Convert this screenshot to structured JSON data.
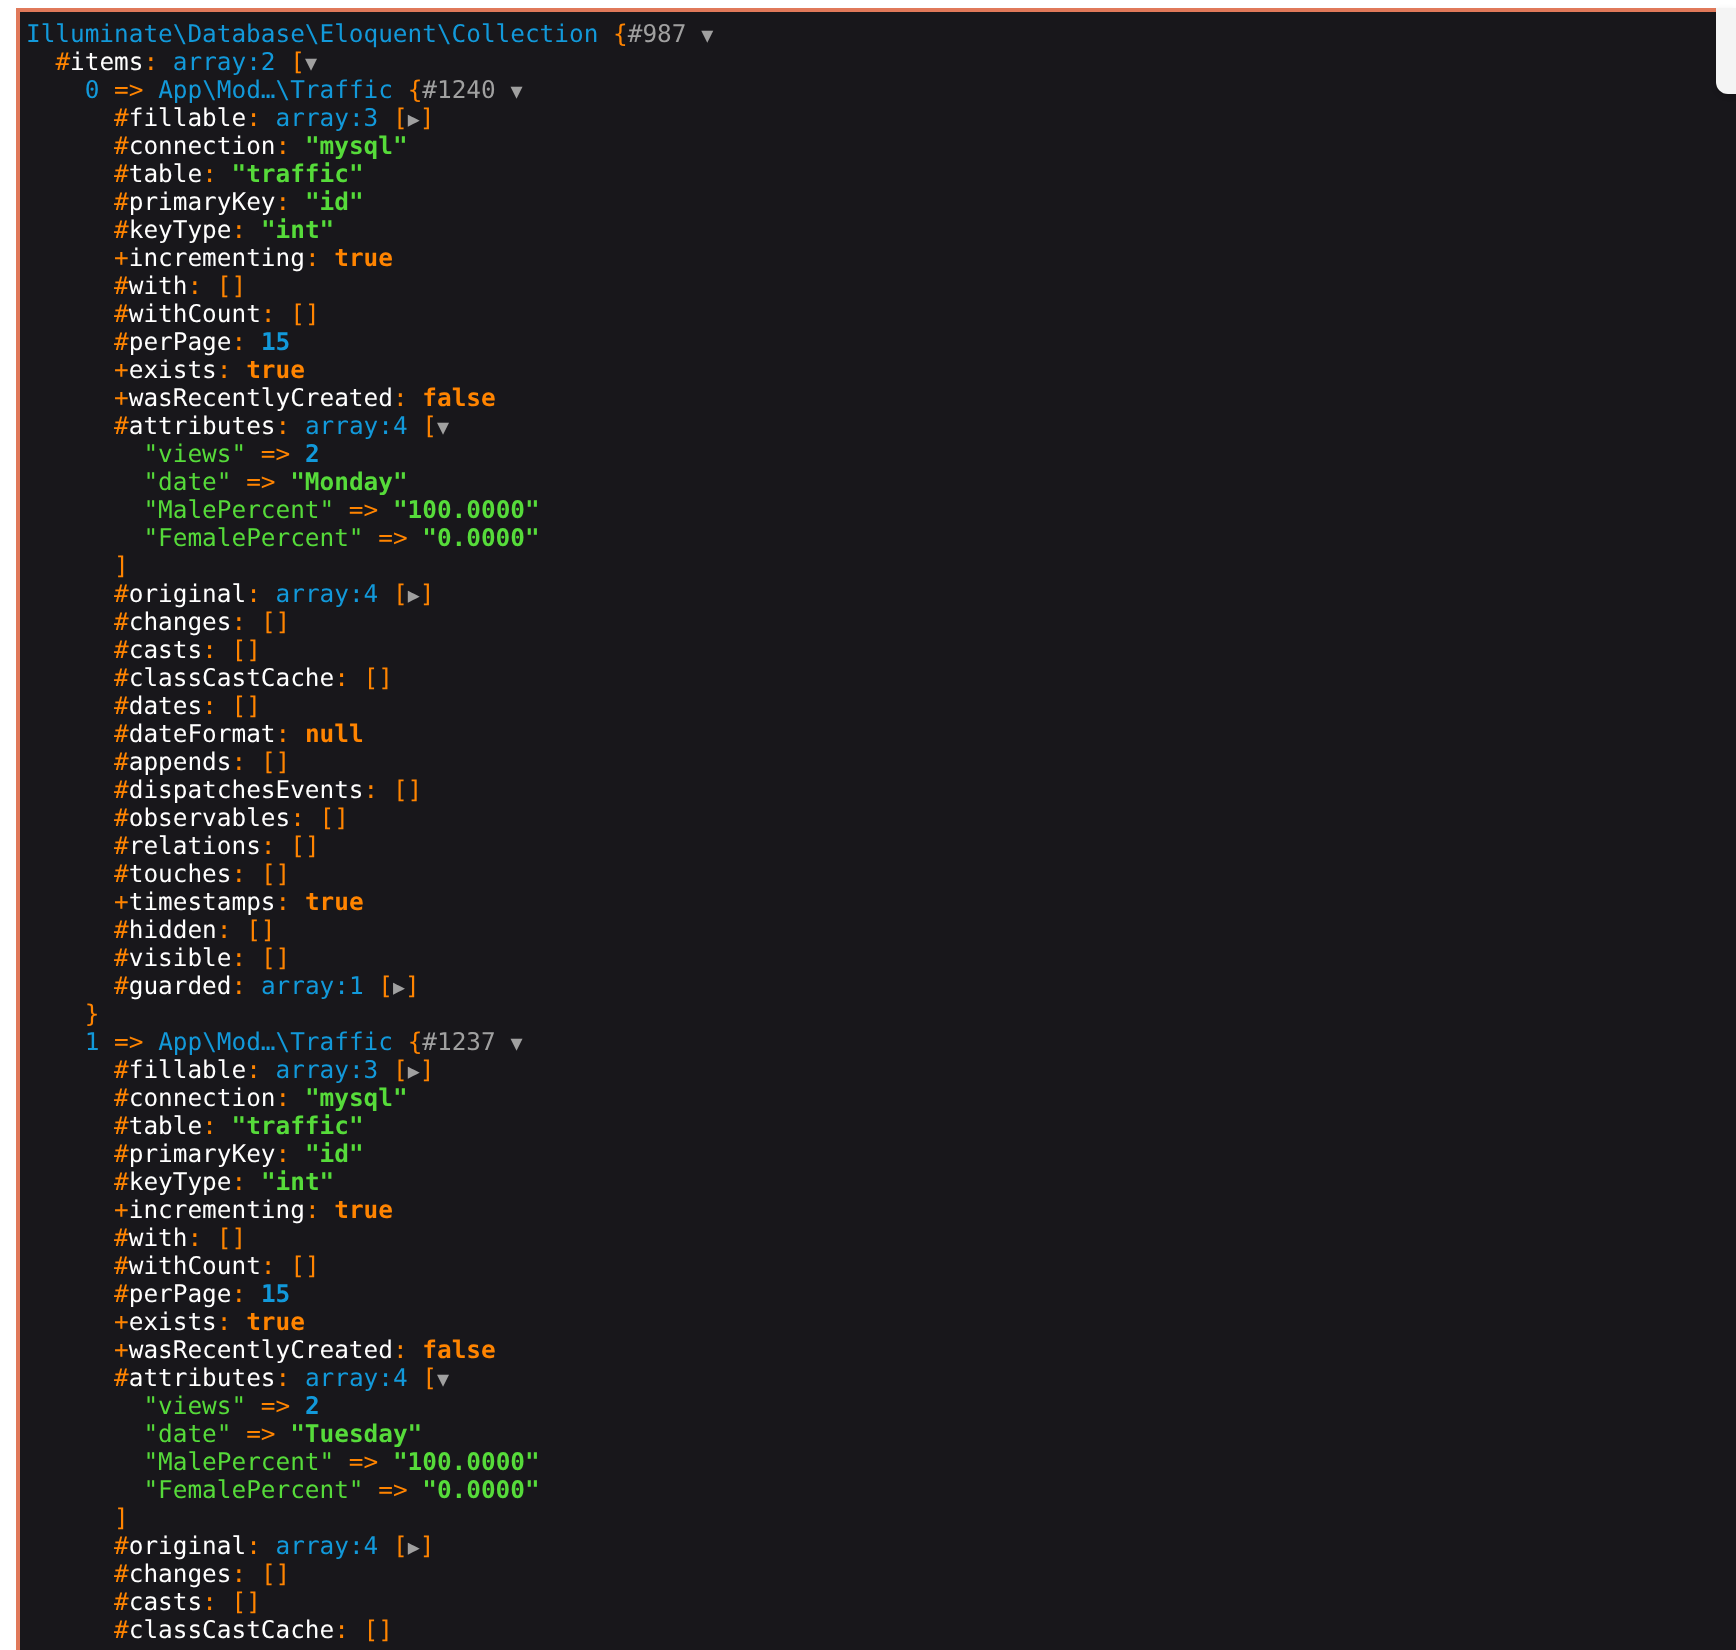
{
  "dump": {
    "value": {
      "text": "Illuminate\\Database\\Eloquent\\Collection",
      "kind": "class"
    },
    "open": "{",
    "ref": "#987",
    "toggle": "▼",
    "children": [
      {
        "key": {
          "prefix": "#",
          "text": "items",
          "kind": "property"
        },
        "sep": ": ",
        "value": {
          "text": "array:2",
          "kind": "note"
        },
        "open": "[",
        "toggle": "▼",
        "children": [
          {
            "key": {
              "text": "0",
              "kind": "index"
            },
            "sep": " => ",
            "value": {
              "text": "App\\Mod…\\Traffic",
              "kind": "class"
            },
            "open": "{",
            "ref": "#1240",
            "toggle": "▼",
            "close": "}",
            "children": [
              {
                "key": {
                  "prefix": "#",
                  "text": "fillable",
                  "kind": "property"
                },
                "sep": ": ",
                "value": {
                  "text": "array:3",
                  "kind": "note"
                },
                "open": "[",
                "toggle": "▶",
                "close": "]"
              },
              {
                "key": {
                  "prefix": "#",
                  "text": "connection",
                  "kind": "property"
                },
                "sep": ": ",
                "value": {
                  "text": "\"mysql\"",
                  "kind": "string"
                }
              },
              {
                "key": {
                  "prefix": "#",
                  "text": "table",
                  "kind": "property"
                },
                "sep": ": ",
                "value": {
                  "text": "\"traffic\"",
                  "kind": "string"
                }
              },
              {
                "key": {
                  "prefix": "#",
                  "text": "primaryKey",
                  "kind": "property"
                },
                "sep": ": ",
                "value": {
                  "text": "\"id\"",
                  "kind": "string"
                }
              },
              {
                "key": {
                  "prefix": "#",
                  "text": "keyType",
                  "kind": "property"
                },
                "sep": ": ",
                "value": {
                  "text": "\"int\"",
                  "kind": "string"
                }
              },
              {
                "key": {
                  "prefix": "+",
                  "text": "incrementing",
                  "kind": "property"
                },
                "sep": ": ",
                "value": {
                  "text": "true",
                  "kind": "const"
                }
              },
              {
                "key": {
                  "prefix": "#",
                  "text": "with",
                  "kind": "property"
                },
                "sep": ": ",
                "value": {
                  "text": "[]",
                  "kind": "empty"
                }
              },
              {
                "key": {
                  "prefix": "#",
                  "text": "withCount",
                  "kind": "property"
                },
                "sep": ": ",
                "value": {
                  "text": "[]",
                  "kind": "empty"
                }
              },
              {
                "key": {
                  "prefix": "#",
                  "text": "perPage",
                  "kind": "property"
                },
                "sep": ": ",
                "value": {
                  "text": "15",
                  "kind": "number"
                }
              },
              {
                "key": {
                  "prefix": "+",
                  "text": "exists",
                  "kind": "property"
                },
                "sep": ": ",
                "value": {
                  "text": "true",
                  "kind": "const"
                }
              },
              {
                "key": {
                  "prefix": "+",
                  "text": "wasRecentlyCreated",
                  "kind": "property"
                },
                "sep": ": ",
                "value": {
                  "text": "false",
                  "kind": "const"
                }
              },
              {
                "key": {
                  "prefix": "#",
                  "text": "attributes",
                  "kind": "property"
                },
                "sep": ": ",
                "value": {
                  "text": "array:4",
                  "kind": "note"
                },
                "open": "[",
                "toggle": "▼",
                "close": "]",
                "children": [
                  {
                    "key": {
                      "text": "\"views\"",
                      "kind": "string"
                    },
                    "sep": " => ",
                    "value": {
                      "text": "2",
                      "kind": "number"
                    }
                  },
                  {
                    "key": {
                      "text": "\"date\"",
                      "kind": "string"
                    },
                    "sep": " => ",
                    "value": {
                      "text": "\"Monday\"",
                      "kind": "string"
                    }
                  },
                  {
                    "key": {
                      "text": "\"MalePercent\"",
                      "kind": "string"
                    },
                    "sep": " => ",
                    "value": {
                      "text": "\"100.0000\"",
                      "kind": "string"
                    }
                  },
                  {
                    "key": {
                      "text": "\"FemalePercent\"",
                      "kind": "string"
                    },
                    "sep": " => ",
                    "value": {
                      "text": "\"0.0000\"",
                      "kind": "string"
                    }
                  }
                ]
              },
              {
                "key": {
                  "prefix": "#",
                  "text": "original",
                  "kind": "property"
                },
                "sep": ": ",
                "value": {
                  "text": "array:4",
                  "kind": "note"
                },
                "open": "[",
                "toggle": "▶",
                "close": "]"
              },
              {
                "key": {
                  "prefix": "#",
                  "text": "changes",
                  "kind": "property"
                },
                "sep": ": ",
                "value": {
                  "text": "[]",
                  "kind": "empty"
                }
              },
              {
                "key": {
                  "prefix": "#",
                  "text": "casts",
                  "kind": "property"
                },
                "sep": ": ",
                "value": {
                  "text": "[]",
                  "kind": "empty"
                }
              },
              {
                "key": {
                  "prefix": "#",
                  "text": "classCastCache",
                  "kind": "property"
                },
                "sep": ": ",
                "value": {
                  "text": "[]",
                  "kind": "empty"
                }
              },
              {
                "key": {
                  "prefix": "#",
                  "text": "dates",
                  "kind": "property"
                },
                "sep": ": ",
                "value": {
                  "text": "[]",
                  "kind": "empty"
                }
              },
              {
                "key": {
                  "prefix": "#",
                  "text": "dateFormat",
                  "kind": "property"
                },
                "sep": ": ",
                "value": {
                  "text": "null",
                  "kind": "const"
                }
              },
              {
                "key": {
                  "prefix": "#",
                  "text": "appends",
                  "kind": "property"
                },
                "sep": ": ",
                "value": {
                  "text": "[]",
                  "kind": "empty"
                }
              },
              {
                "key": {
                  "prefix": "#",
                  "text": "dispatchesEvents",
                  "kind": "property"
                },
                "sep": ": ",
                "value": {
                  "text": "[]",
                  "kind": "empty"
                }
              },
              {
                "key": {
                  "prefix": "#",
                  "text": "observables",
                  "kind": "property"
                },
                "sep": ": ",
                "value": {
                  "text": "[]",
                  "kind": "empty"
                }
              },
              {
                "key": {
                  "prefix": "#",
                  "text": "relations",
                  "kind": "property"
                },
                "sep": ": ",
                "value": {
                  "text": "[]",
                  "kind": "empty"
                }
              },
              {
                "key": {
                  "prefix": "#",
                  "text": "touches",
                  "kind": "property"
                },
                "sep": ": ",
                "value": {
                  "text": "[]",
                  "kind": "empty"
                }
              },
              {
                "key": {
                  "prefix": "+",
                  "text": "timestamps",
                  "kind": "property"
                },
                "sep": ": ",
                "value": {
                  "text": "true",
                  "kind": "const"
                }
              },
              {
                "key": {
                  "prefix": "#",
                  "text": "hidden",
                  "kind": "property"
                },
                "sep": ": ",
                "value": {
                  "text": "[]",
                  "kind": "empty"
                }
              },
              {
                "key": {
                  "prefix": "#",
                  "text": "visible",
                  "kind": "property"
                },
                "sep": ": ",
                "value": {
                  "text": "[]",
                  "kind": "empty"
                }
              },
              {
                "key": {
                  "prefix": "#",
                  "text": "guarded",
                  "kind": "property"
                },
                "sep": ": ",
                "value": {
                  "text": "array:1",
                  "kind": "note"
                },
                "open": "[",
                "toggle": "▶",
                "close": "]"
              }
            ]
          },
          {
            "key": {
              "text": "1",
              "kind": "index"
            },
            "sep": " => ",
            "value": {
              "text": "App\\Mod…\\Traffic",
              "kind": "class"
            },
            "open": "{",
            "ref": "#1237",
            "toggle": "▼",
            "children": [
              {
                "key": {
                  "prefix": "#",
                  "text": "fillable",
                  "kind": "property"
                },
                "sep": ": ",
                "value": {
                  "text": "array:3",
                  "kind": "note"
                },
                "open": "[",
                "toggle": "▶",
                "close": "]"
              },
              {
                "key": {
                  "prefix": "#",
                  "text": "connection",
                  "kind": "property"
                },
                "sep": ": ",
                "value": {
                  "text": "\"mysql\"",
                  "kind": "string"
                }
              },
              {
                "key": {
                  "prefix": "#",
                  "text": "table",
                  "kind": "property"
                },
                "sep": ": ",
                "value": {
                  "text": "\"traffic\"",
                  "kind": "string"
                }
              },
              {
                "key": {
                  "prefix": "#",
                  "text": "primaryKey",
                  "kind": "property"
                },
                "sep": ": ",
                "value": {
                  "text": "\"id\"",
                  "kind": "string"
                }
              },
              {
                "key": {
                  "prefix": "#",
                  "text": "keyType",
                  "kind": "property"
                },
                "sep": ": ",
                "value": {
                  "text": "\"int\"",
                  "kind": "string"
                }
              },
              {
                "key": {
                  "prefix": "+",
                  "text": "incrementing",
                  "kind": "property"
                },
                "sep": ": ",
                "value": {
                  "text": "true",
                  "kind": "const"
                }
              },
              {
                "key": {
                  "prefix": "#",
                  "text": "with",
                  "kind": "property"
                },
                "sep": ": ",
                "value": {
                  "text": "[]",
                  "kind": "empty"
                }
              },
              {
                "key": {
                  "prefix": "#",
                  "text": "withCount",
                  "kind": "property"
                },
                "sep": ": ",
                "value": {
                  "text": "[]",
                  "kind": "empty"
                }
              },
              {
                "key": {
                  "prefix": "#",
                  "text": "perPage",
                  "kind": "property"
                },
                "sep": ": ",
                "value": {
                  "text": "15",
                  "kind": "number"
                }
              },
              {
                "key": {
                  "prefix": "+",
                  "text": "exists",
                  "kind": "property"
                },
                "sep": ": ",
                "value": {
                  "text": "true",
                  "kind": "const"
                }
              },
              {
                "key": {
                  "prefix": "+",
                  "text": "wasRecentlyCreated",
                  "kind": "property"
                },
                "sep": ": ",
                "value": {
                  "text": "false",
                  "kind": "const"
                }
              },
              {
                "key": {
                  "prefix": "#",
                  "text": "attributes",
                  "kind": "property"
                },
                "sep": ": ",
                "value": {
                  "text": "array:4",
                  "kind": "note"
                },
                "open": "[",
                "toggle": "▼",
                "close": "]",
                "children": [
                  {
                    "key": {
                      "text": "\"views\"",
                      "kind": "string"
                    },
                    "sep": " => ",
                    "value": {
                      "text": "2",
                      "kind": "number"
                    }
                  },
                  {
                    "key": {
                      "text": "\"date\"",
                      "kind": "string"
                    },
                    "sep": " => ",
                    "value": {
                      "text": "\"Tuesday\"",
                      "kind": "string"
                    }
                  },
                  {
                    "key": {
                      "text": "\"MalePercent\"",
                      "kind": "string"
                    },
                    "sep": " => ",
                    "value": {
                      "text": "\"100.0000\"",
                      "kind": "string"
                    }
                  },
                  {
                    "key": {
                      "text": "\"FemalePercent\"",
                      "kind": "string"
                    },
                    "sep": " => ",
                    "value": {
                      "text": "\"0.0000\"",
                      "kind": "string"
                    }
                  }
                ]
              },
              {
                "key": {
                  "prefix": "#",
                  "text": "original",
                  "kind": "property"
                },
                "sep": ": ",
                "value": {
                  "text": "array:4",
                  "kind": "note"
                },
                "open": "[",
                "toggle": "▶",
                "close": "]"
              },
              {
                "key": {
                  "prefix": "#",
                  "text": "changes",
                  "kind": "property"
                },
                "sep": ": ",
                "value": {
                  "text": "[]",
                  "kind": "empty"
                }
              },
              {
                "key": {
                  "prefix": "#",
                  "text": "casts",
                  "kind": "property"
                },
                "sep": ": ",
                "value": {
                  "text": "[]",
                  "kind": "empty"
                }
              },
              {
                "key": {
                  "prefix": "#",
                  "text": "classCastCache",
                  "kind": "property"
                },
                "sep": ": ",
                "value": {
                  "text": "[]",
                  "kind": "empty"
                }
              }
            ]
          }
        ]
      }
    ]
  }
}
